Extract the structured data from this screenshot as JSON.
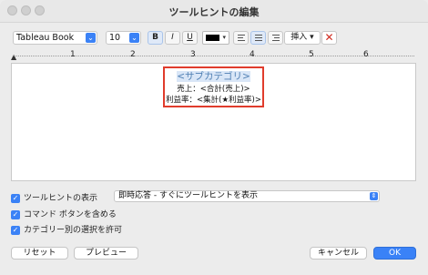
{
  "window": {
    "title": "ツールヒントの編集"
  },
  "toolbar": {
    "font_family": "Tableau Book",
    "font_size": "10",
    "bold_label": "B",
    "italic_label": "I",
    "underline_label": "U",
    "text_color": "#000000",
    "insert_label": "挿入 ▾",
    "alignment_selected": "center"
  },
  "ruler": {
    "marks": [
      "1",
      "2",
      "3",
      "4",
      "5",
      "6"
    ]
  },
  "editor": {
    "lines": [
      "<サブカテゴリ>",
      "売上：<合計(売上)>",
      "利益率：<集計(★利益率)>"
    ],
    "highlight_color": "#e03c2c"
  },
  "options": {
    "show_tooltips": "ツールヒントの表示",
    "tooltip_mode": "即時応答 - すぐにツールヒントを表示",
    "include_command_buttons": "コマンド ボタンを含める",
    "allow_selection_by_category": "カテゴリー別の選択を許可"
  },
  "buttons": {
    "reset": "リセット",
    "preview": "プレビュー",
    "cancel": "キャンセル",
    "ok": "OK"
  }
}
